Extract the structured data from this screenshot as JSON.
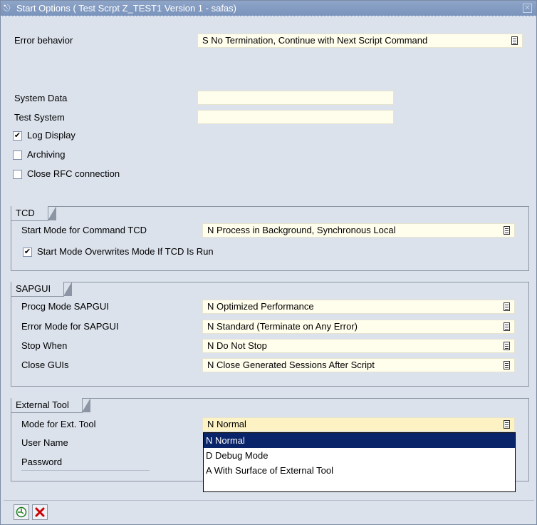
{
  "window": {
    "title": "Start Options ( Test Scrpt Z_TEST1 Version 1 - safas)"
  },
  "general": {
    "error_behavior_label": "Error behavior",
    "error_behavior_value": "S No Termination, Continue with Next Script Command",
    "system_data_label": "System Data",
    "system_data_value": "",
    "test_system_label": "Test System",
    "test_system_value": "",
    "log_display_label": "Log Display",
    "log_display_checked": true,
    "archiving_label": "Archiving",
    "archiving_checked": false,
    "close_rfc_label": "Close RFC connection",
    "close_rfc_checked": false
  },
  "tcd": {
    "title": "TCD",
    "start_mode_label": "Start Mode for Command TCD",
    "start_mode_value": "N Process in Background, Synchronous Local",
    "overwrite_label": "Start Mode Overwrites Mode If TCD Is Run",
    "overwrite_checked": true
  },
  "sapgui": {
    "title": "SAPGUI",
    "procg_mode_label": "Procg Mode SAPGUI",
    "procg_mode_value": "N Optimized Performance",
    "error_mode_label": "Error Mode for SAPGUI",
    "error_mode_value": "N Standard (Terminate on Any Error)",
    "stop_when_label": "Stop When",
    "stop_when_value": "N Do Not Stop",
    "close_guis_label": "Close GUIs",
    "close_guis_value": "N Close Generated Sessions After Script"
  },
  "external_tool": {
    "title": "External Tool",
    "mode_label": "Mode for Ext. Tool",
    "mode_value": "N Normal",
    "user_name_label": "User Name",
    "password_label": "Password",
    "options": [
      "N Normal",
      "D Debug Mode",
      "A  With Surface of External Tool"
    ],
    "selected_index": 0
  },
  "toolbar": {
    "execute_icon": "execute-icon",
    "cancel_icon": "cancel-icon"
  },
  "colors": {
    "title_bar": "#7a93bb",
    "input_bg": "#fffdec",
    "selected_option": "#0a246a",
    "cancel_red": "#cc0000"
  }
}
